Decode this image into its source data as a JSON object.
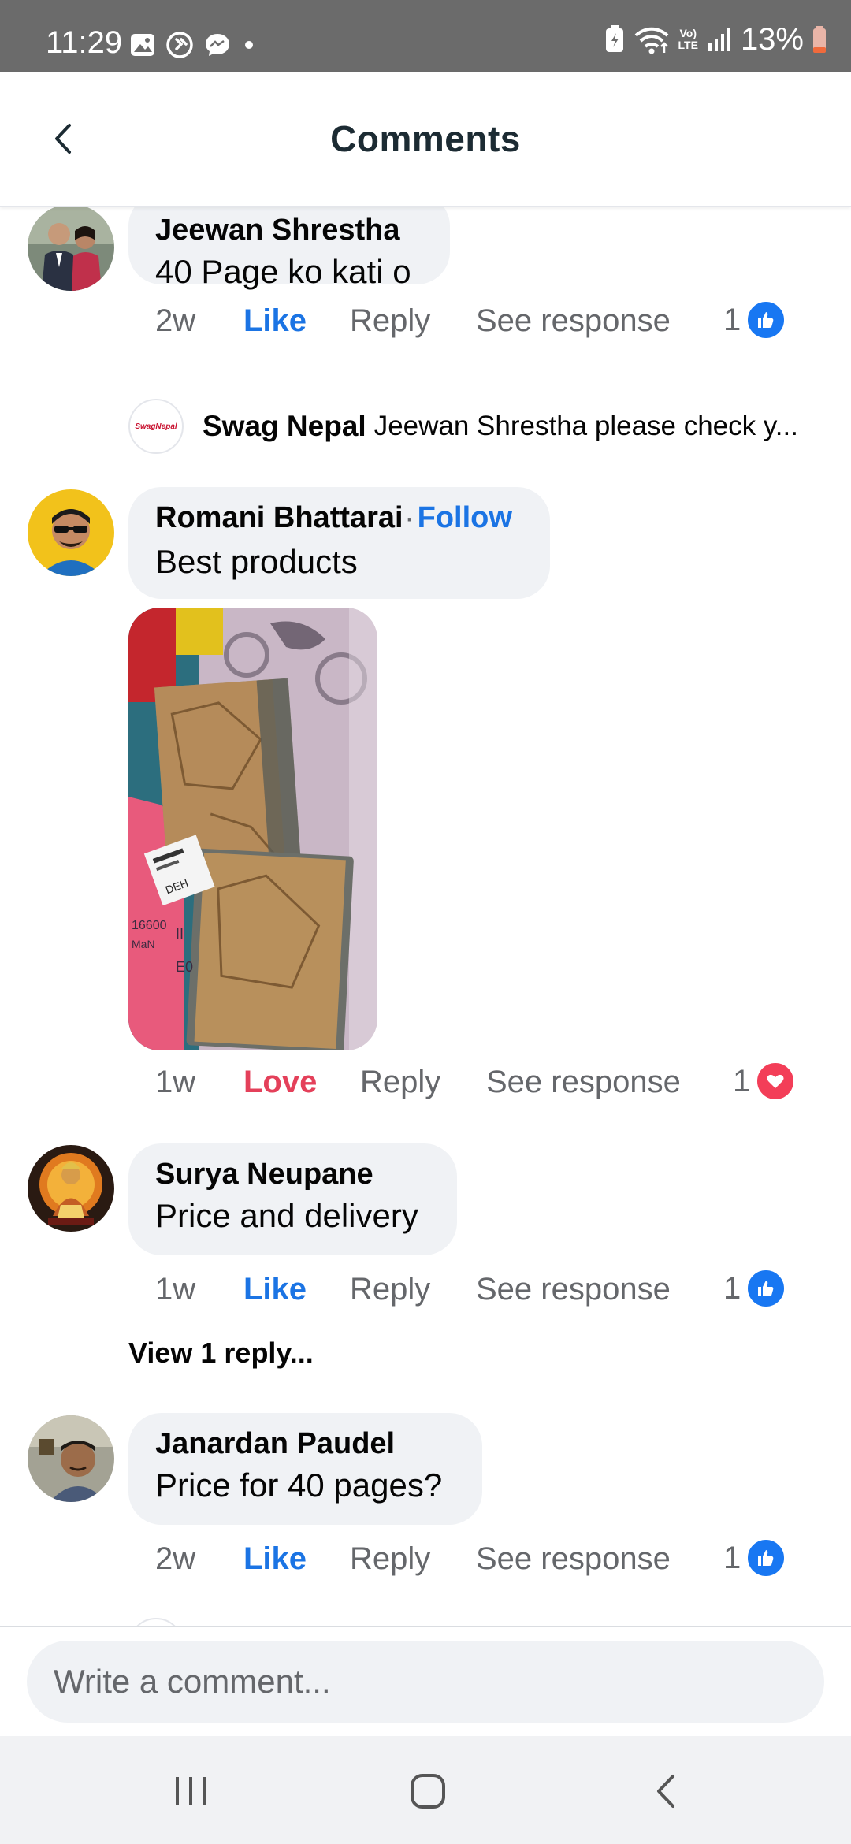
{
  "status_bar": {
    "time": "11:29",
    "battery_percent": "13%",
    "network_label_top": "Vo)",
    "network_label_bottom": "LTE",
    "icons": [
      "gallery-icon",
      "shazam-icon",
      "messenger-icon",
      "dot-icon",
      "battery-saver-icon",
      "wifi-icon",
      "signal-icon",
      "battery-icon"
    ]
  },
  "header": {
    "title": "Comments",
    "back_icon": "chevron-left-icon"
  },
  "comments": [
    {
      "author": "Jeewan Shrestha",
      "text": "40 Page ko kati o",
      "time": "2w",
      "reaction_label": "Like",
      "reply_label": "Reply",
      "see_response_label": "See response",
      "reaction_count": "1",
      "reaction_type": "like",
      "reply_preview": {
        "author": "Swag Nepal",
        "text": "Jeewan Shrestha please check y...",
        "logo_text": "SwagNepal"
      }
    },
    {
      "author": "Romani Bhattarai",
      "follow_label": "Follow",
      "text": "Best products",
      "time": "1w",
      "reaction_label": "Love",
      "reply_label": "Reply",
      "see_response_label": "See response",
      "reaction_count": "1",
      "reaction_type": "love",
      "image_text": [
        "DEH",
        "16600",
        "MaN",
        "II",
        "E0"
      ]
    },
    {
      "author": "Surya Neupane",
      "text": "Price and delivery",
      "time": "1w",
      "reaction_label": "Like",
      "reply_label": "Reply",
      "see_response_label": "See response",
      "reaction_count": "1",
      "reaction_type": "like",
      "view_replies": "View 1 reply..."
    },
    {
      "author": "Janardan Paudel",
      "text": "Price for 40 pages?",
      "time": "2w",
      "reaction_label": "Like",
      "reply_label": "Reply",
      "see_response_label": "See response",
      "reaction_count": "1",
      "reaction_type": "like"
    }
  ],
  "composer": {
    "placeholder": "Write a comment..."
  },
  "nav_bar": {
    "icons": [
      "recent-apps-icon",
      "home-icon",
      "back-icon"
    ]
  },
  "colors": {
    "accent": "#1b74e4",
    "love": "#e4405a",
    "bubble": "#f0f2f5",
    "status_bar": "#6b6b6b"
  }
}
